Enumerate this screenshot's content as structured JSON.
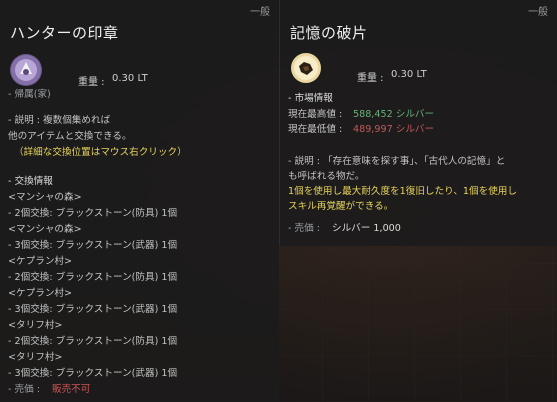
{
  "left_tooltip": {
    "badge": "一般",
    "title": "ハンターの印章",
    "icon": "hunter-seal-icon",
    "weight_label": "重量 :",
    "weight_value": "0.30 LT",
    "binding": "- 帰属(家)",
    "description_lines": [
      "- 説明 : 複数個集めれば",
      "他のアイテムと交換できる。",
      "（詳細な交換位置はマウス右クリック）"
    ],
    "exchange_header": "- 交換情報",
    "exchange_lines": [
      "<マンシャの森>",
      "- 2個交換: ブラックストーン(防具) 1個",
      "<マンシャの森>",
      "- 3個交換: ブラックストーン(武器) 1個",
      "<ケプラン村>",
      "- 2個交換: ブラックストーン(防具) 1個",
      "<ケプラン村>",
      "- 3個交換: ブラックストーン(武器) 1個",
      "<タリフ村>",
      "- 2個交換: ブラックストーン(防具) 1個",
      "<タリフ村>",
      "- 3個交換: ブラックストーン(武器) 1個"
    ],
    "sell_label": "- 売価 :",
    "sell_value": "販売不可"
  },
  "right_tooltip": {
    "badge": "一般",
    "title": "記憶の破片",
    "icon": "memory-fragment-icon",
    "weight_label": "重量 :",
    "weight_value": "0.30 LT",
    "market_header": "- 市場情報",
    "market_max_label": "現在最高値 :",
    "market_max_value": "588,452 シルバー",
    "market_min_label": "現在最低値 :",
    "market_min_value": "489,997 シルバー",
    "description_lines": [
      "- 説明 : 「存在意味を探す事」、「古代人の記憶」とも呼ばれる物だ。"
    ],
    "description_line1": "- 説明 : 「存在意味を探す事」、「古代人の記憶」と",
    "description_line2": "も呼ばれる物だ。",
    "effect_line1": "1個を使用し最大耐久度を1復旧したり、1個を使用し",
    "effect_line2": "スキル再覚醒ができる。",
    "sell_label": "- 売価 :",
    "sell_value": "シルバー 1,000"
  },
  "colors": {
    "yellow_text": "#e7d35a",
    "red_text": "#d15555",
    "green_text": "#66b07a",
    "pink_text": "#c05a5a"
  }
}
